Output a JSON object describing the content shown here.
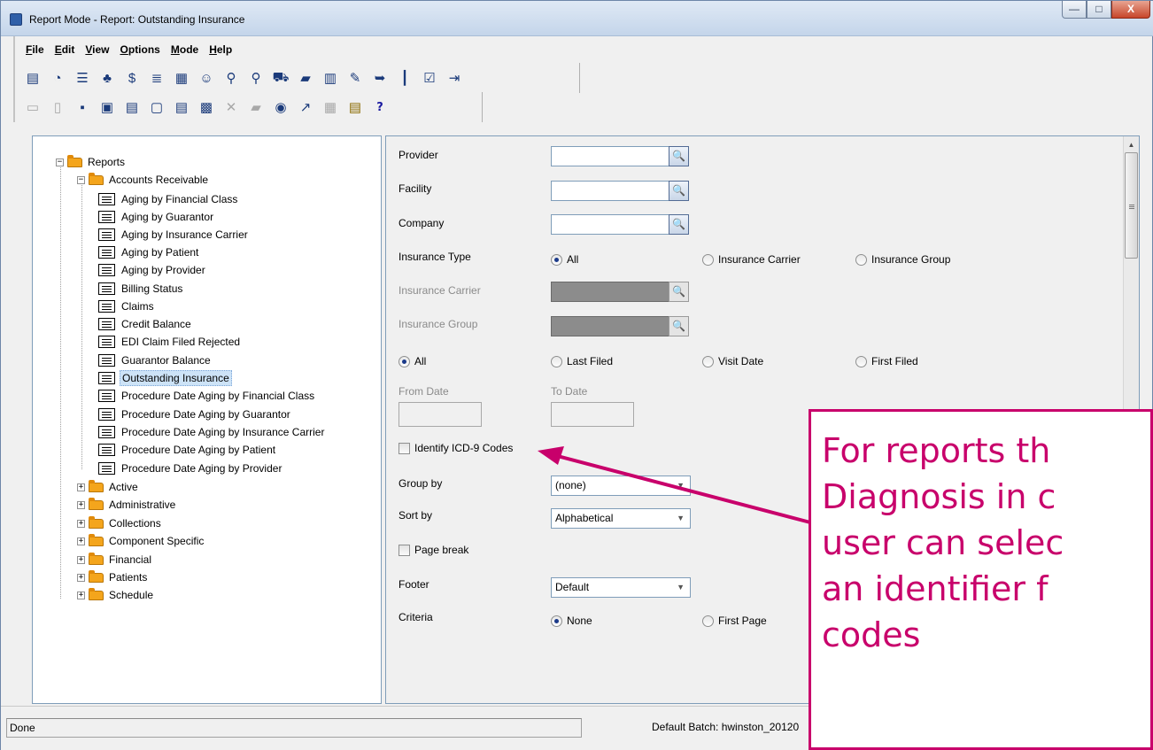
{
  "window": {
    "title": "Report Mode - Report: Outstanding Insurance",
    "min_glyph": "—",
    "max_glyph": "□",
    "close_glyph": "X"
  },
  "menu": [
    {
      "underline": "F",
      "rest": "ile"
    },
    {
      "underline": "E",
      "rest": "dit"
    },
    {
      "underline": "V",
      "rest": "iew"
    },
    {
      "underline": "O",
      "rest": "ptions"
    },
    {
      "underline": "M",
      "rest": "ode"
    },
    {
      "underline": "H",
      "rest": "elp"
    }
  ],
  "toolbar1_icons": [
    "report-list-icon",
    "timer-icon",
    "list-icon",
    "org-chart-icon",
    "dollar-icon",
    "ledger-icon",
    "calculator-icon",
    "user-icon",
    "search-user-icon",
    "search-icon",
    "car-icon",
    "folder-open-icon",
    "form-icon",
    "wrench-icon",
    "export-icon",
    "chart-icon",
    "checklist-icon",
    "exit-door-icon"
  ],
  "toolbar2_icons": [
    "open-disabled-icon",
    "new-doc-icon",
    "save-icon",
    "save-as-icon",
    "print-icon",
    "print-preview-icon",
    "printer-icon",
    "find-icon",
    "delete-icon",
    "refresh-icon",
    "globe-icon",
    "edit-chart-icon",
    "grid-icon",
    "notes-icon",
    "help-icon"
  ],
  "tree": {
    "root": "Reports",
    "group_open": "Accounts Receivable",
    "reports": [
      "Aging by Financial Class",
      "Aging by Guarantor",
      "Aging by Insurance Carrier",
      "Aging by Patient",
      "Aging by Provider",
      "Billing Status",
      "Claims",
      "Credit Balance",
      "EDI Claim Filed Rejected",
      "Guarantor Balance",
      "Outstanding Insurance",
      "Procedure Date Aging by Financial Class",
      "Procedure Date Aging by Guarantor",
      "Procedure Date Aging by Insurance Carrier",
      "Procedure Date Aging by Patient",
      "Procedure Date Aging by Provider"
    ],
    "selected": "Outstanding Insurance",
    "collapsed_groups": [
      "Active",
      "Administrative",
      "Collections",
      "Component Specific",
      "Financial",
      "Patients",
      "Schedule"
    ]
  },
  "form": {
    "provider_label": "Provider",
    "facility_label": "Facility",
    "company_label": "Company",
    "insurance_type_label": "Insurance Type",
    "ins_type_options": [
      "All",
      "Insurance Carrier",
      "Insurance Group"
    ],
    "ins_type_selected": "All",
    "insurance_carrier_label": "Insurance Carrier",
    "insurance_group_label": "Insurance Group",
    "date_options": [
      "All",
      "Last Filed",
      "Visit Date",
      "First Filed"
    ],
    "date_selected": "All",
    "from_date_label": "From Date",
    "to_date_label": "To Date",
    "identify_icd9_label": "Identify ICD-9 Codes",
    "group_by_label": "Group by",
    "group_by_value": "(none)",
    "sort_by_label": "Sort by",
    "sort_by_value": "Alphabetical",
    "page_break_label": "Page break",
    "footer_label": "Footer",
    "footer_value": "Default",
    "criteria_label": "Criteria",
    "criteria_options": [
      "None",
      "First Page"
    ],
    "criteria_selected": "None"
  },
  "status": {
    "left": "Done",
    "right": "Default Batch: hwinston_20120"
  },
  "callout": {
    "lines": [
      "For reports th",
      "Diagnosis in c",
      "user can selec",
      "an identifier f",
      "codes"
    ],
    "color": "#c8006b"
  }
}
